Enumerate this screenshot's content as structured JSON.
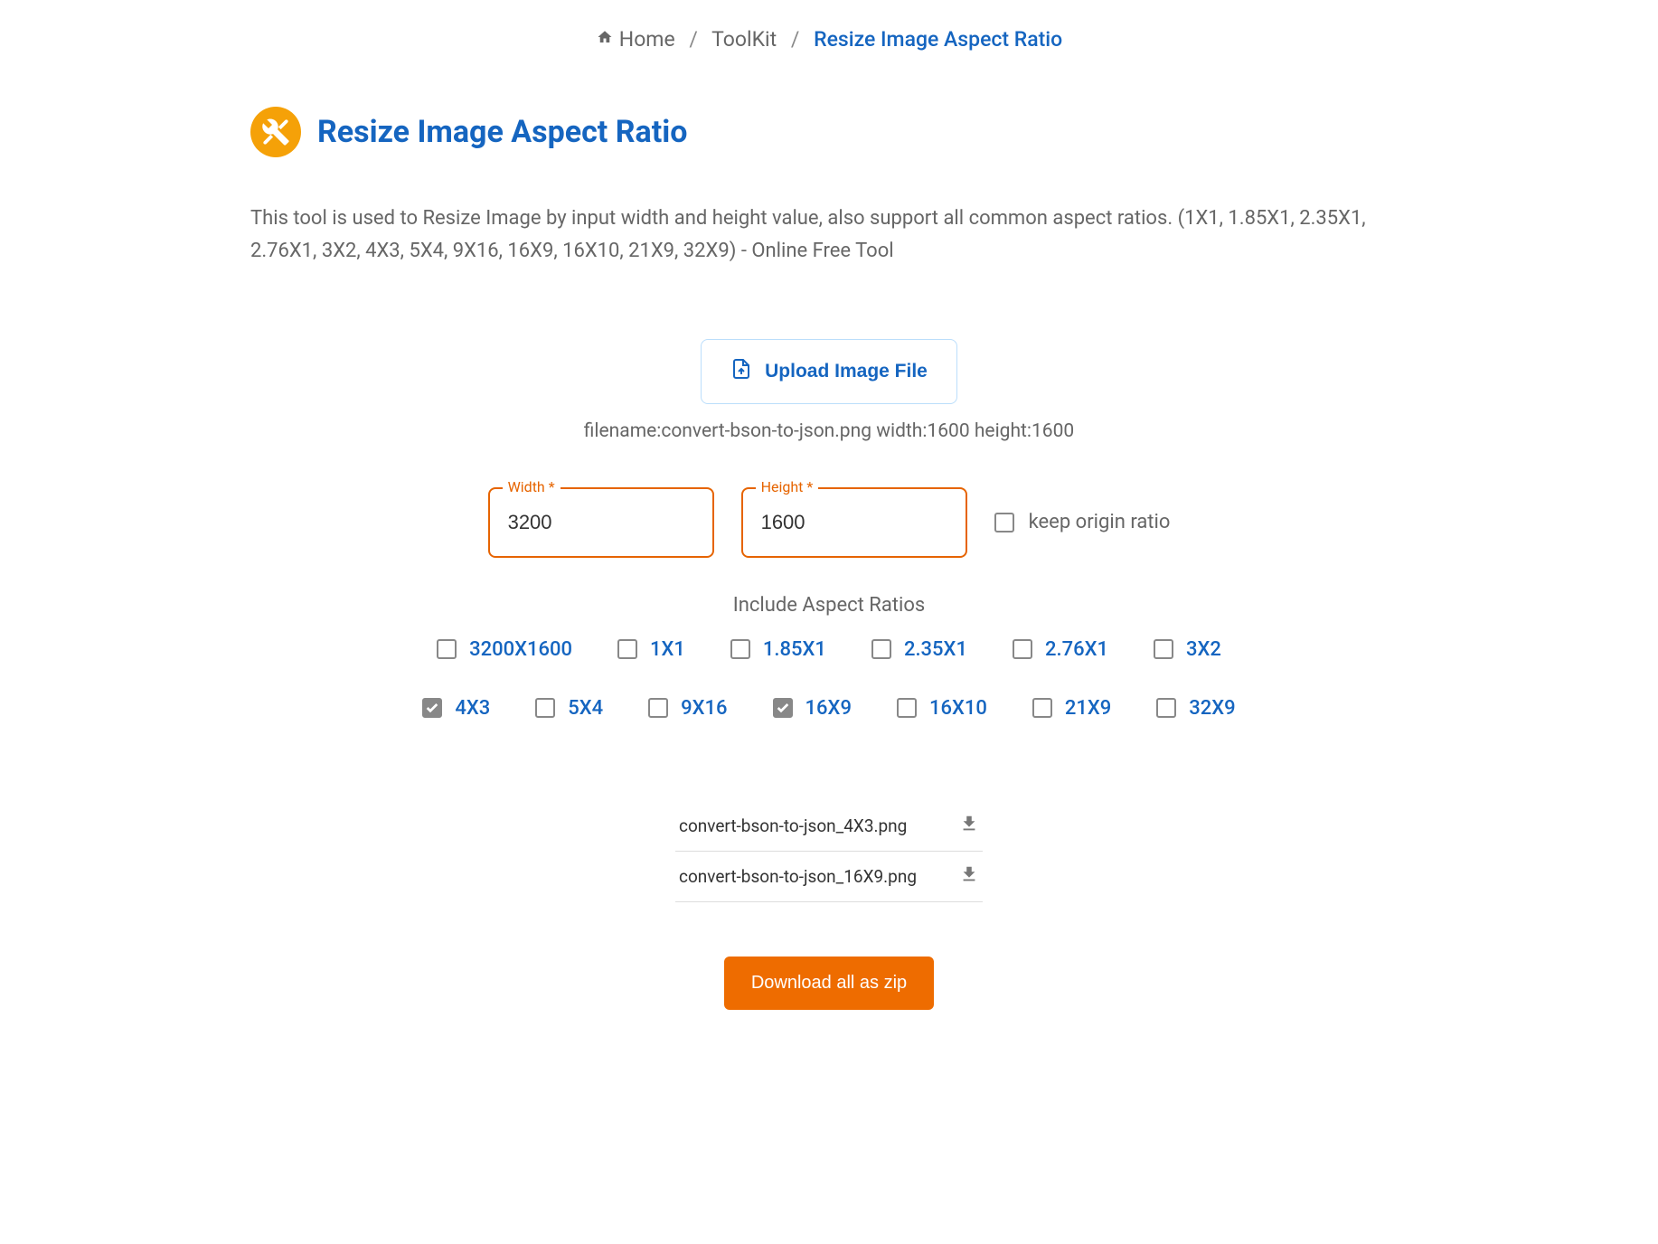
{
  "breadcrumb": {
    "home": "Home",
    "toolkit": "ToolKit",
    "current": "Resize Image Aspect Ratio"
  },
  "page": {
    "title": "Resize Image Aspect Ratio",
    "description": "This tool is used to Resize Image by input width and height value, also support all common aspect ratios. (1X1, 1.85X1, 2.35X1, 2.76X1, 3X2, 4X3, 5X4, 9X16, 16X9, 16X10, 21X9, 32X9) - Online Free Tool"
  },
  "upload": {
    "button_label": "Upload Image File",
    "file_info": "filename:convert-bson-to-json.png width:1600 height:1600"
  },
  "fields": {
    "width_label": "Width *",
    "width_value": "3200",
    "height_label": "Height *",
    "height_value": "1600",
    "keep_ratio_label": "keep origin ratio",
    "keep_ratio_checked": false
  },
  "ratios": {
    "title": "Include Aspect Ratios",
    "items": [
      {
        "label": "3200X1600",
        "checked": false
      },
      {
        "label": "1X1",
        "checked": false
      },
      {
        "label": "1.85X1",
        "checked": false
      },
      {
        "label": "2.35X1",
        "checked": false
      },
      {
        "label": "2.76X1",
        "checked": false
      },
      {
        "label": "3X2",
        "checked": false
      },
      {
        "label": "4X3",
        "checked": true
      },
      {
        "label": "5X4",
        "checked": false
      },
      {
        "label": "9X16",
        "checked": false
      },
      {
        "label": "16X9",
        "checked": true
      },
      {
        "label": "16X10",
        "checked": false
      },
      {
        "label": "21X9",
        "checked": false
      },
      {
        "label": "32X9",
        "checked": false
      }
    ]
  },
  "results": [
    {
      "filename": "convert-bson-to-json_4X3.png"
    },
    {
      "filename": "convert-bson-to-json_16X9.png"
    }
  ],
  "download_all_label": "Download all as zip"
}
